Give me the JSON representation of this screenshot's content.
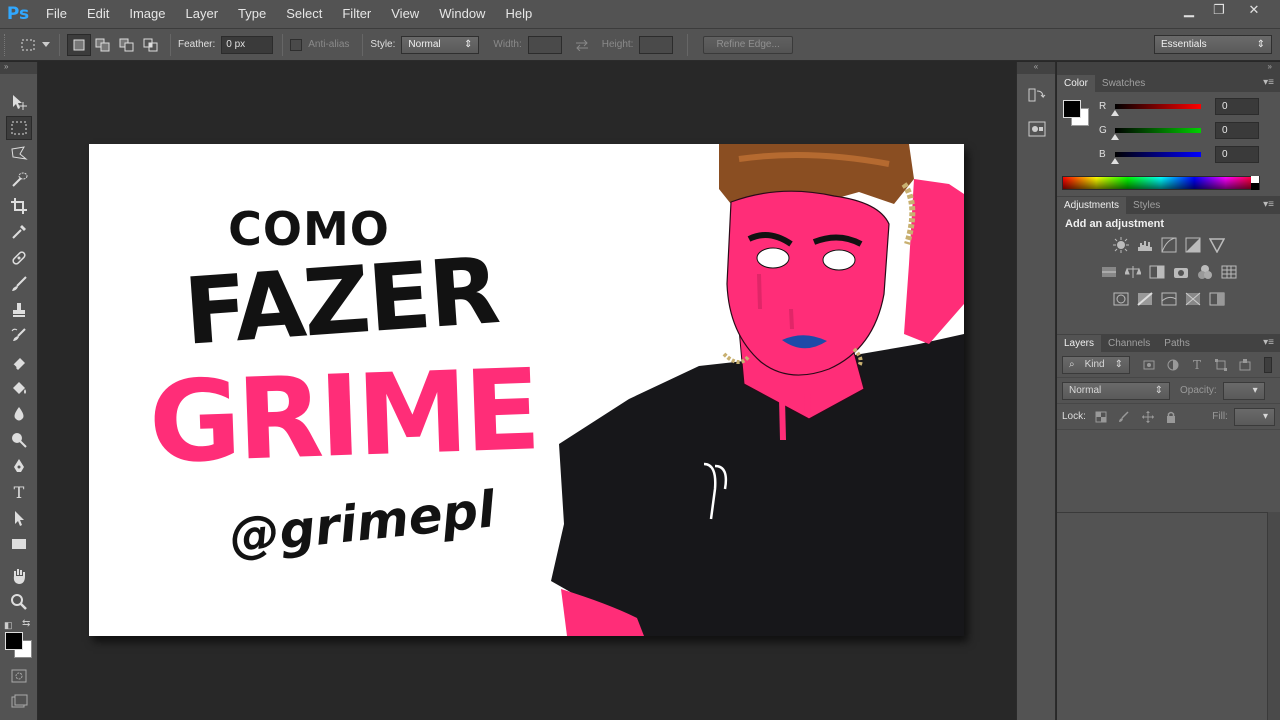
{
  "app": {
    "logo": "Ps"
  },
  "menu": [
    "File",
    "Edit",
    "Image",
    "Layer",
    "Type",
    "Select",
    "Filter",
    "View",
    "Window",
    "Help"
  ],
  "window_controls": {
    "minimize": "▁",
    "restore": "❐",
    "close": "✕"
  },
  "options": {
    "feather_label": "Feather:",
    "feather_value": "0 px",
    "antialias_label": "Anti-alias",
    "style_label": "Style:",
    "style_value": "Normal",
    "width_label": "Width:",
    "height_label": "Height:",
    "refine_edge": "Refine Edge...",
    "workspace": "Essentials"
  },
  "toolbar": {
    "collapse": "»",
    "tools": [
      "move-tool",
      "marquee-tool",
      "lasso-tool",
      "quick-selection-tool",
      "crop-tool",
      "eyedropper-tool",
      "healing-brush-tool",
      "brush-tool",
      "clone-stamp-tool",
      "history-brush-tool",
      "eraser-tool",
      "paint-bucket-tool",
      "blur-tool",
      "dodge-tool",
      "pen-tool",
      "type-tool",
      "path-selection-tool",
      "rectangle-tool",
      "hand-tool",
      "zoom-tool"
    ],
    "active_tool": "marquee-tool",
    "foreground_color": "#000000",
    "background_color": "#ffffff"
  },
  "canvas": {
    "line1": "COMO",
    "line2": "FAZER",
    "line3": "GRIME",
    "handle": "@grimepl",
    "accent_color": "#ff2d78"
  },
  "strip": {
    "collapse": "«",
    "expand": "»"
  },
  "color_panel": {
    "tabs": [
      "Color",
      "Swatches"
    ],
    "active_tab": "Color",
    "channels": [
      {
        "letter": "R",
        "value": "0",
        "color": "#ff0000"
      },
      {
        "letter": "G",
        "value": "0",
        "color": "#00d000"
      },
      {
        "letter": "B",
        "value": "0",
        "color": "#0000ff"
      }
    ]
  },
  "adjustments_panel": {
    "tabs": [
      "Adjustments",
      "Styles"
    ],
    "active_tab": "Adjustments",
    "title": "Add an adjustment"
  },
  "layers_panel": {
    "tabs": [
      "Layers",
      "Channels",
      "Paths"
    ],
    "active_tab": "Layers",
    "filter_label": "Kind",
    "blend_mode": "Normal",
    "opacity_label": "Opacity:",
    "lock_label": "Lock:",
    "fill_label": "Fill:"
  },
  "panel_menu_glyph": "▾≡"
}
